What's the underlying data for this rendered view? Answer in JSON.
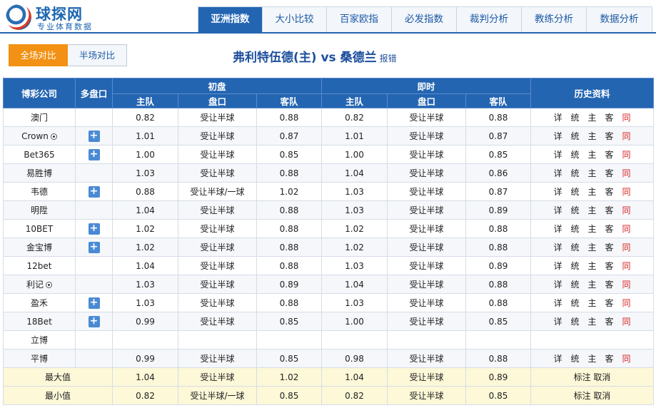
{
  "header": {
    "logo_title": "球探网",
    "logo_sub": "专业体育数据",
    "tabs": [
      "亚洲指数",
      "大小比较",
      "百家欧指",
      "必发指数",
      "裁判分析",
      "教练分析",
      "数据分析"
    ],
    "active_tab": "亚洲指数"
  },
  "subbar": {
    "full": "全场对比",
    "half": "半场对比"
  },
  "match": {
    "title": "弗利特伍德(主) vs 桑德兰",
    "report": "报错"
  },
  "table": {
    "head_company": "博彩公司",
    "head_multi": "多盘口",
    "head_initial": "初盘",
    "head_live": "即时",
    "head_history": "历史资料",
    "sub_home": "主队",
    "sub_line": "盘口",
    "sub_away": "客队",
    "history_links": [
      "详",
      "统",
      "主",
      "客",
      "同"
    ],
    "rows": [
      {
        "company": "澳门",
        "ball": false,
        "plus": false,
        "i_home": "0.82",
        "i_line": "受让半球",
        "i_away": "0.88",
        "l_home": "0.82",
        "l_line": "受让半球",
        "l_away": "0.88"
      },
      {
        "company": "Crown",
        "ball": true,
        "plus": true,
        "i_home": "1.01",
        "i_line": "受让半球",
        "i_away": "0.87",
        "l_home": "1.01",
        "l_line": "受让半球",
        "l_away": "0.87"
      },
      {
        "company": "Bet365",
        "ball": false,
        "plus": true,
        "i_home": "1.00",
        "i_line": "受让半球",
        "i_away": "0.85",
        "l_home": "1.00",
        "l_line": "受让半球",
        "l_away": "0.85"
      },
      {
        "company": "易胜博",
        "ball": false,
        "plus": false,
        "i_home": "1.03",
        "i_line": "受让半球",
        "i_away": "0.88",
        "l_home": "1.04",
        "l_line": "受让半球",
        "l_away": "0.86"
      },
      {
        "company": "韦德",
        "ball": false,
        "plus": true,
        "i_home": "0.88",
        "i_line": "受让半球/一球",
        "i_away": "1.02",
        "l_home": "1.03",
        "l_line": "受让半球",
        "l_away": "0.87"
      },
      {
        "company": "明陞",
        "ball": false,
        "plus": false,
        "i_home": "1.04",
        "i_line": "受让半球",
        "i_away": "0.88",
        "l_home": "1.03",
        "l_line": "受让半球",
        "l_away": "0.89"
      },
      {
        "company": "10BET",
        "ball": false,
        "plus": true,
        "i_home": "1.02",
        "i_line": "受让半球",
        "i_away": "0.88",
        "l_home": "1.02",
        "l_line": "受让半球",
        "l_away": "0.88"
      },
      {
        "company": "金宝博",
        "ball": false,
        "plus": true,
        "i_home": "1.02",
        "i_line": "受让半球",
        "i_away": "0.88",
        "l_home": "1.02",
        "l_line": "受让半球",
        "l_away": "0.88"
      },
      {
        "company": "12bet",
        "ball": false,
        "plus": false,
        "i_home": "1.04",
        "i_line": "受让半球",
        "i_away": "0.88",
        "l_home": "1.03",
        "l_line": "受让半球",
        "l_away": "0.89"
      },
      {
        "company": "利记",
        "ball": true,
        "plus": false,
        "i_home": "1.03",
        "i_line": "受让半球",
        "i_away": "0.89",
        "l_home": "1.04",
        "l_line": "受让半球",
        "l_away": "0.88"
      },
      {
        "company": "盈禾",
        "ball": false,
        "plus": true,
        "i_home": "1.03",
        "i_line": "受让半球",
        "i_away": "0.88",
        "l_home": "1.03",
        "l_line": "受让半球",
        "l_away": "0.88"
      },
      {
        "company": "18Bet",
        "ball": false,
        "plus": true,
        "i_home": "0.99",
        "i_line": "受让半球",
        "i_away": "0.85",
        "l_home": "1.00",
        "l_line": "受让半球",
        "l_away": "0.85"
      },
      {
        "company": "立博",
        "ball": false,
        "plus": false,
        "empty": true,
        "i_home": "",
        "i_line": "",
        "i_away": "",
        "l_home": "",
        "l_line": "",
        "l_away": ""
      },
      {
        "company": "平博",
        "ball": false,
        "plus": false,
        "i_home": "0.99",
        "i_line": "受让半球",
        "i_away": "0.85",
        "l_home": "0.98",
        "l_line": "受让半球",
        "l_away": "0.88"
      }
    ],
    "summary": [
      {
        "label": "最大值",
        "i_home": "1.04",
        "i_line": "受让半球",
        "i_away": "1.02",
        "l_home": "1.04",
        "l_line": "受让半球",
        "l_away": "0.89",
        "action": "标注 取消"
      },
      {
        "label": "最小值",
        "i_home": "0.82",
        "i_line": "受让半球/一球",
        "i_away": "0.85",
        "l_home": "0.82",
        "l_line": "受让半球",
        "l_away": "0.85",
        "action": "标注 取消"
      }
    ]
  }
}
